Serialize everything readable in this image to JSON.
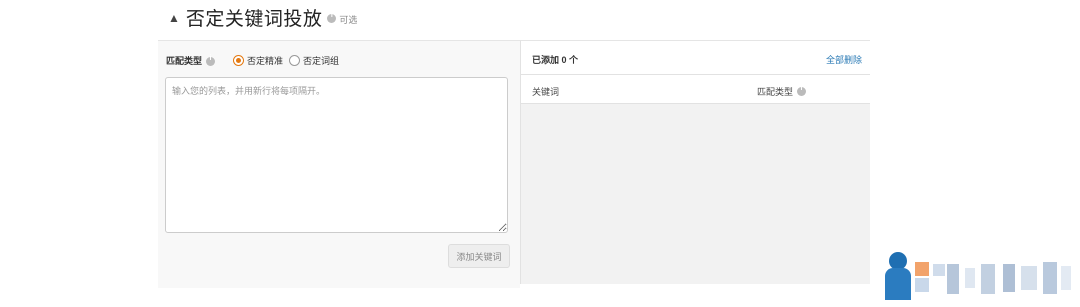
{
  "section": {
    "caret_icon": "chevron-up-icon",
    "title": "否定关键词投放",
    "optional_label": "可选"
  },
  "left_panel": {
    "match_type_label": "匹配类型",
    "radio_options": [
      {
        "label": "否定精准",
        "checked": true
      },
      {
        "label": "否定词组",
        "checked": false
      }
    ],
    "textarea_placeholder": "输入您的列表，并用新行将每项隔开。",
    "textarea_value": "",
    "add_button_label": "添加关键词"
  },
  "right_panel": {
    "added_count_label": "已添加 0 个",
    "remove_all_label": "全部删除",
    "columns": [
      "关键词",
      "匹配类型"
    ]
  },
  "colors": {
    "accent_orange": "#e47911",
    "link_blue": "#2a7ab5"
  }
}
